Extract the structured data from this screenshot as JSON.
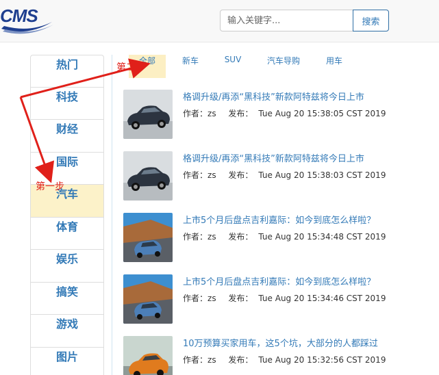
{
  "header": {
    "logo_text": "CMS",
    "search_placeholder": "输入关键字...",
    "search_button": "搜索"
  },
  "sidebar": {
    "items": [
      {
        "label": "热门"
      },
      {
        "label": "科技"
      },
      {
        "label": "财经"
      },
      {
        "label": "国际"
      },
      {
        "label": "汽车",
        "active": true
      },
      {
        "label": "体育"
      },
      {
        "label": "娱乐"
      },
      {
        "label": "搞笑"
      },
      {
        "label": "游戏"
      },
      {
        "label": "图片"
      }
    ]
  },
  "tabs": [
    {
      "label": "全部",
      "active": true
    },
    {
      "label": "新车"
    },
    {
      "label": "SUV"
    },
    {
      "label": "汽车导购"
    },
    {
      "label": "用车"
    }
  ],
  "news": [
    {
      "title": "格调升级/再添“黑科技”新款阿特兹将今日上市",
      "author_label": "作者：",
      "author": "zs",
      "publish_label": "发布：",
      "date": "Tue Aug 20 15:38:05 CST 2019",
      "thumb_icon": "sedan-photo"
    },
    {
      "title": "格调升级/再添“黑科技”新款阿特兹将今日上市",
      "author_label": "作者：",
      "author": "zs",
      "publish_label": "发布：",
      "date": "Tue Aug 20 15:38:03 CST 2019",
      "thumb_icon": "sedan-photo"
    },
    {
      "title": "上市5个月后盘点吉利嘉际：如今到底怎么样啦？",
      "author_label": "作者：",
      "author": "zs",
      "publish_label": "发布：",
      "date": "Tue Aug 20 15:34:48 CST 2019",
      "thumb_icon": "mpv-road-photo"
    },
    {
      "title": "上市5个月后盘点吉利嘉际：如今到底怎么样啦？",
      "author_label": "作者：",
      "author": "zs",
      "publish_label": "发布：",
      "date": "Tue Aug 20 15:34:46 CST 2019",
      "thumb_icon": "mpv-road-photo"
    },
    {
      "title": "10万预算买家用车，这5个坑，大部分的人都踩过",
      "author_label": "作者：",
      "author": "zs",
      "publish_label": "发布：",
      "date": "Tue Aug 20 15:32:56 CST 2019",
      "thumb_icon": "orange-car-photo"
    }
  ],
  "annotations": {
    "step1": "第一步",
    "step2": "第二步"
  },
  "colors": {
    "link": "#337ab7",
    "active_bg": "#fcf2c9",
    "annotation": "#e0201a"
  }
}
